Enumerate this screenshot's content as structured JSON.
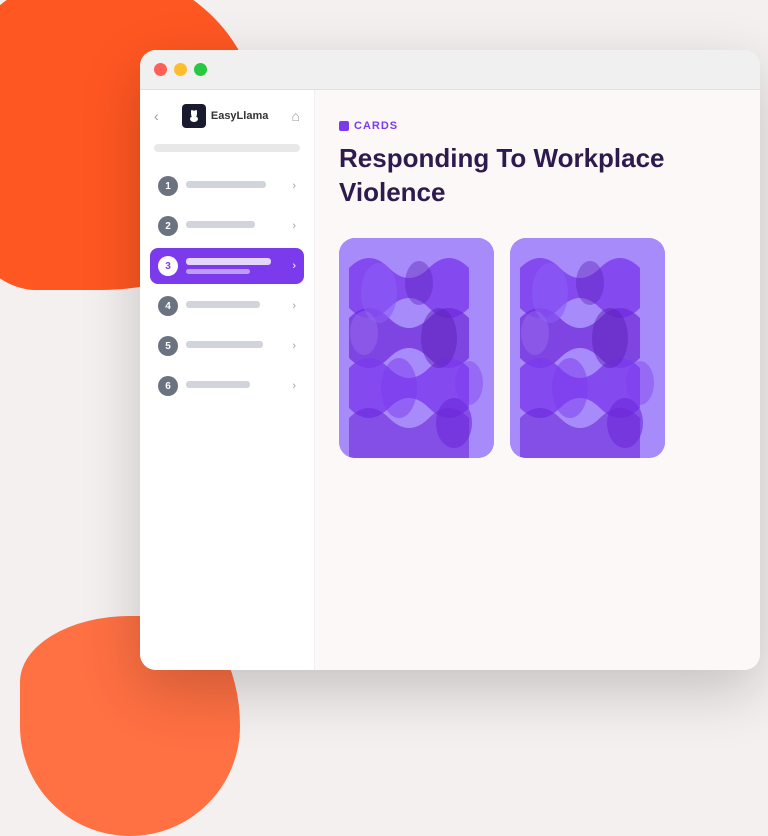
{
  "background": {
    "blob_color_main": "#ff5722",
    "blob_color_secondary": "#ff7043"
  },
  "browser": {
    "traffic_lights": [
      "red",
      "yellow",
      "green"
    ]
  },
  "sidebar": {
    "back_label": "‹",
    "logo_text": "EasyLlama",
    "home_label": "⌂",
    "items": [
      {
        "number": "1",
        "active": false
      },
      {
        "number": "2",
        "active": false
      },
      {
        "number": "3",
        "active": true
      },
      {
        "number": "4",
        "active": false
      },
      {
        "number": "5",
        "active": false
      },
      {
        "number": "6",
        "active": false
      }
    ]
  },
  "main": {
    "badge_text": "CARDS",
    "title_line1": "Responding To Workplace",
    "title_line2": "Violence",
    "cards": [
      {
        "id": 1
      },
      {
        "id": 2
      }
    ]
  }
}
